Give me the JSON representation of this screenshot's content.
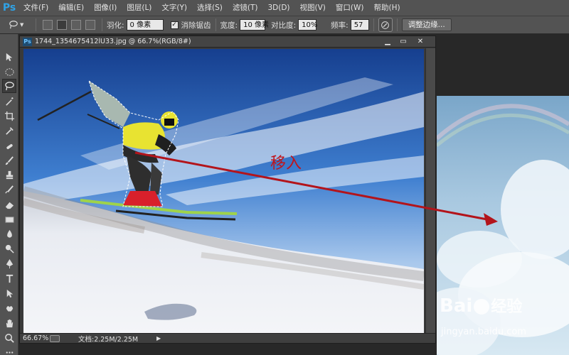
{
  "app": {
    "logo": "Ps"
  },
  "menu": [
    "文件(F)",
    "编辑(E)",
    "图像(I)",
    "图层(L)",
    "文字(Y)",
    "选择(S)",
    "滤镜(T)",
    "3D(D)",
    "视图(V)",
    "窗口(W)",
    "帮助(H)"
  ],
  "options": {
    "feather_label": "羽化:",
    "feather_value": "0 像素",
    "antialias_label": "消除锯齿",
    "width_label": "宽度:",
    "width_value": "10 像素",
    "contrast_label": "对比度:",
    "contrast_value": "10%",
    "frequency_label": "频率:",
    "frequency_value": "57",
    "refine_edge_button": "调整边缘..."
  },
  "document": {
    "title": "1744_1354675412lU33.jpg @ 66.7%(RGB/8#)",
    "zoom": "66.67%",
    "doc_info": "文档:2.25M/2.25M"
  },
  "annotation": {
    "text": "移入",
    "color": "#c0141b"
  },
  "watermark": {
    "brand_main": "Bai",
    "brand_suffix": "经验",
    "url": "jingyan.baidu.com"
  },
  "colors": {
    "accent": "#2fa3e7",
    "panel": "#535353",
    "arrow": "#b3141b"
  }
}
